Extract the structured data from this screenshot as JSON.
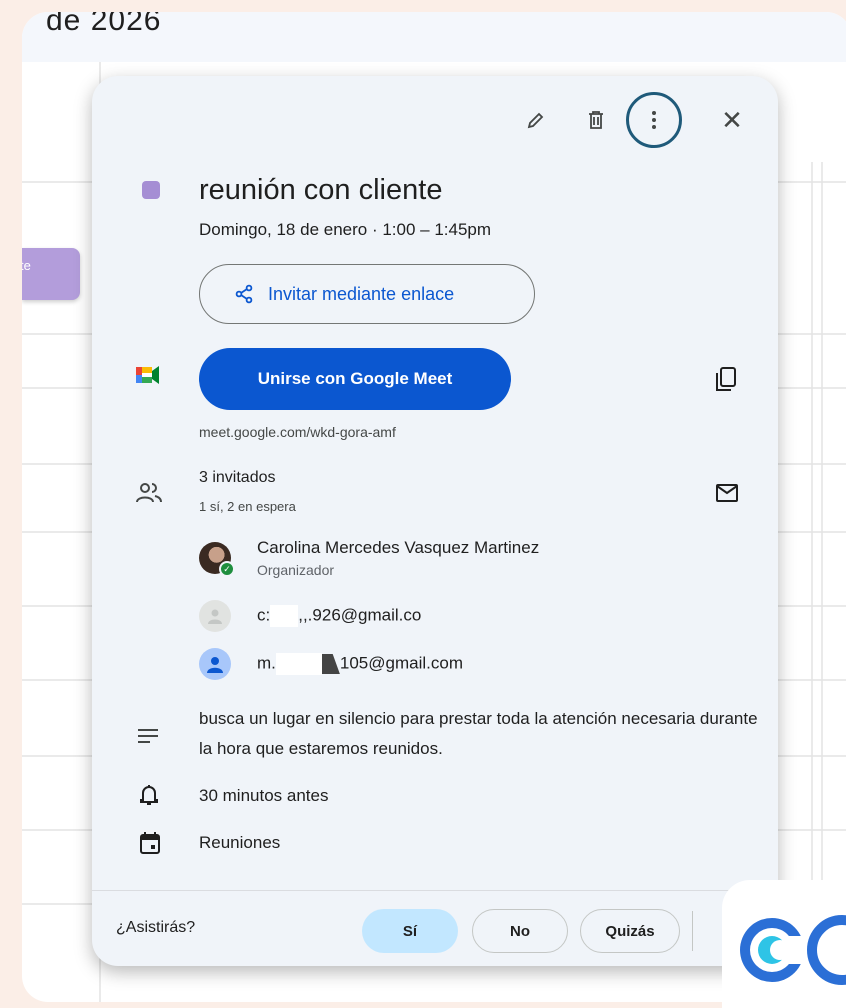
{
  "background": {
    "header_date": "de 2026",
    "side_event_label": "te"
  },
  "toolbar": {
    "edit_icon": "pencil-icon",
    "delete_icon": "trash-icon",
    "more_icon": "more-vert-icon",
    "close_icon": "close-icon",
    "close_glyph": "✕"
  },
  "event": {
    "color": "#a58ed4",
    "title": "reunión con cliente",
    "date_line": "Domingo, 18 de enero  ·  1:00 – 1:45pm",
    "invite_label": "Invitar mediante enlace",
    "meet_label": "Unirse con Google Meet",
    "meet_link": "meet.google.com/wkd-gora-amf"
  },
  "guests": {
    "count": "3 invitados",
    "status": "1 sí, 2 en espera",
    "list": [
      {
        "name": "Carolina Mercedes Vasquez Martinez",
        "role": "Organizador"
      },
      {
        "name_start": "c:",
        "name_mid": ",,.",
        "name_end": "926@gmail.co"
      },
      {
        "name_start": "m.",
        "name_end": "105@gmail.com"
      }
    ]
  },
  "description": "busca un lugar en silencio para prestar toda la atención necesaria durante la hora que estaremos reunidos.",
  "reminder": "30 minutos antes",
  "calendar": "Reuniones",
  "rsvp": {
    "question": "¿Asistirás?",
    "yes": "Sí",
    "no": "No",
    "maybe": "Quizás"
  },
  "colors": {
    "accent": "#0b57d0",
    "rsvp_selected": "#c2e7ff",
    "card_bg": "#f0f4f9"
  }
}
